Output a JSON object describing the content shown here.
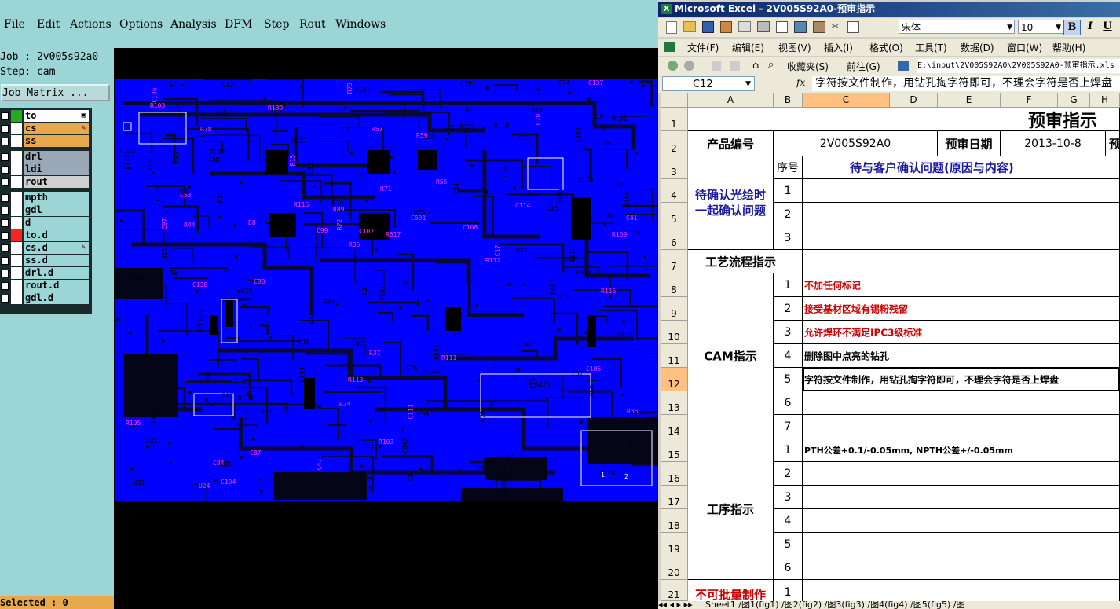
{
  "cam": {
    "menu": [
      "File",
      "Edit",
      "Actions",
      "Options",
      "Analysis",
      "DFM",
      "Step",
      "Rout",
      "Windows"
    ],
    "job_label": "Job : 2v005s92a0",
    "step_label": "Step: cam",
    "job_matrix_label": "Job Matrix ...",
    "selected_label": "Selected : 0",
    "layers": [
      {
        "name": "to",
        "swatch": "#22aa22",
        "bg": "#ffffff",
        "mark": "▣"
      },
      {
        "name": "cs",
        "swatch": "#ffffff",
        "bg": "#e8a84c",
        "mark": "✎"
      },
      {
        "name": "ss",
        "swatch": "#ffffff",
        "bg": "#e8a84c",
        "mark": ""
      },
      {
        "name": "drl",
        "swatch": "#ffffff",
        "bg": "#9aa8b8",
        "mark": ""
      },
      {
        "name": "ldi",
        "swatch": "#ffffff",
        "bg": "#9aa8b8",
        "mark": ""
      },
      {
        "name": "rout",
        "swatch": "#ffffff",
        "bg": "#d0d0d0",
        "mark": ""
      },
      {
        "name": "mpth",
        "swatch": "#ffffff",
        "bg": "#9cd5d5",
        "mark": ""
      },
      {
        "name": "gdl",
        "swatch": "#ffffff",
        "bg": "#9cd5d5",
        "mark": ""
      },
      {
        "name": "d",
        "swatch": "#ffffff",
        "bg": "#9cd5d5",
        "mark": ""
      },
      {
        "name": "to.d",
        "swatch": "#ff2222",
        "bg": "#9cd5d5",
        "mark": ""
      },
      {
        "name": "cs.d",
        "swatch": "#ffffff",
        "bg": "#9cd5d5",
        "mark": "✎"
      },
      {
        "name": "ss.d",
        "swatch": "#ffffff",
        "bg": "#9cd5d5",
        "mark": ""
      },
      {
        "name": "drl.d",
        "swatch": "#ffffff",
        "bg": "#9cd5d5",
        "mark": ""
      },
      {
        "name": "rout.d",
        "swatch": "#ffffff",
        "bg": "#9cd5d5",
        "mark": ""
      },
      {
        "name": "gdl.d",
        "swatch": "#ffffff",
        "bg": "#9cd5d5",
        "mark": ""
      }
    ],
    "refdes_black": [
      "R128",
      "R108",
      "U35",
      "C136",
      "R117",
      "U15",
      "C38",
      "R47",
      "U9",
      "R44",
      "U8",
      "C137",
      "C138",
      "C84",
      "R113",
      "R116",
      "R60",
      "C36",
      "L37",
      "R120",
      "R119",
      "C32",
      "R43",
      "C37",
      "R66",
      "R607",
      "C129",
      "C132",
      "C133",
      "C130",
      "R106",
      "R112",
      "R105",
      "U34",
      "R52",
      "U10",
      "R55",
      "U1",
      "R5",
      "C5",
      "U2",
      "C76",
      "C3",
      "R67",
      "L202",
      "R62",
      "R601",
      "C7",
      "C39",
      "R14",
      "R11",
      "R6",
      "R618",
      "U5",
      "R22",
      "C602",
      "C81",
      "D15",
      "C10",
      "U4",
      "C73",
      "C12",
      "U12",
      "C31",
      "J2",
      "U3",
      "C601",
      "C34",
      "R70",
      "L14",
      "C62",
      "L15",
      "C83",
      "R73",
      "R74",
      "L16",
      "C117",
      "U31",
      "U23",
      "R76",
      "R603",
      "C113",
      "L33",
      "U27",
      "C89",
      "C88",
      "R128",
      "U36",
      "C116",
      "L25",
      "R103",
      "C74",
      "R102"
    ],
    "refdes_pink": [
      "C136",
      "C137",
      "C138",
      "C84",
      "R113",
      "R116",
      "R139",
      "R112",
      "R105",
      "R111",
      "R109",
      "R72",
      "R73",
      "R74",
      "C70",
      "C41",
      "C47",
      "R89",
      "R103",
      "R103",
      "R71",
      "C87",
      "C17",
      "R15",
      "R37",
      "R55",
      "R44",
      "R35",
      "R36",
      "U24",
      "C99",
      "C97",
      "C108",
      "C111",
      "R78",
      "C105",
      "C104",
      "C107",
      "C53",
      "R59",
      "D8",
      "C601",
      "R115",
      "C114",
      "R57",
      "R617",
      "C88"
    ],
    "pad_labels": [
      "1",
      "2"
    ]
  },
  "excel": {
    "title": "Microsoft Excel - 2V005S92A0-预审指示",
    "font_name": "宋体",
    "font_size": "10",
    "menus": [
      "文件(F)",
      "编辑(E)",
      "视图(V)",
      "插入(I)",
      "格式(O)",
      "工具(T)",
      "数据(D)",
      "窗口(W)",
      "帮助(H)"
    ],
    "favorites_label": "收藏夹(S)",
    "goto_label": "前往(G)",
    "path": "E:\\input\\2V005S92A0\\2V005S92A0-预审指示.xls",
    "name_box": "C12",
    "fx": "fx",
    "formula": "字符按文件制作，用钻孔掏字符即可，不理会字符是否上焊盘",
    "columns": [
      "A",
      "B",
      "C",
      "D",
      "E",
      "F",
      "G",
      "H"
    ],
    "rows": [
      "1",
      "2",
      "3",
      "4",
      "5",
      "6",
      "7",
      "8",
      "9",
      "10",
      "11",
      "12",
      "13",
      "14",
      "15",
      "16",
      "17",
      "18",
      "19",
      "20",
      "21"
    ],
    "sheet_title": "预审指示",
    "product_label": "产品编号",
    "product_value": "2V005S92A0",
    "date_label": "预审日期",
    "date_value": "2013-10-8",
    "col_extra": "预",
    "seq_label": "序号",
    "customer_header": "待与客户确认问题(原因与内容)",
    "confirm_label_1": "待确认光绘时",
    "confirm_label_2": "一起确认问题",
    "process_flow": "工艺流程指示",
    "cam_label": "CAM指示",
    "process_label": "工序指示",
    "no_mass_label": "不可批量制作",
    "seq_confirm": [
      "1",
      "2",
      "3"
    ],
    "seq_cam": [
      "1",
      "2",
      "3",
      "4",
      "5",
      "6",
      "7"
    ],
    "seq_proc": [
      "1",
      "2",
      "3",
      "4",
      "5",
      "6"
    ],
    "seq_last": [
      "1"
    ],
    "cam_items": [
      "不加任何标记",
      "接受基材区域有锡粉残留",
      "允许焊环不满足IPC3级标准",
      "删除图中点亮的钻孔",
      "字符按文件制作，用钻孔掏字符即可，不理会字符是否上焊盘",
      "",
      ""
    ],
    "cam_item_colors": [
      "#cc0000",
      "#cc0000",
      "#cc0000",
      "#000000",
      "#000000",
      "#000000",
      "#000000"
    ],
    "proc_items": [
      "PTH公差+0.1/-0.05mm, NPTH公差+/-0.05mm",
      "",
      "",
      "",
      "",
      ""
    ],
    "sheet_tabs": "Sheet1 /图1(fig1) /图2(fig2) /图3(fig3) /图4(fig4) /图5(fig5) /图"
  }
}
